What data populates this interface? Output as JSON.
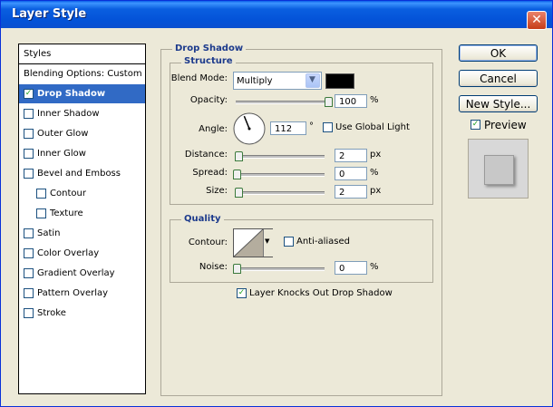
{
  "window": {
    "title": "Layer Style",
    "close_label": "✕"
  },
  "styles_list": {
    "header": "Styles",
    "items": [
      {
        "label": "Blending Options: Custom",
        "checkbox": false,
        "checked": false,
        "indent": 0,
        "selected": false
      },
      {
        "label": "Drop Shadow",
        "checkbox": true,
        "checked": true,
        "indent": 0,
        "selected": true
      },
      {
        "label": "Inner Shadow",
        "checkbox": true,
        "checked": false,
        "indent": 0,
        "selected": false
      },
      {
        "label": "Outer Glow",
        "checkbox": true,
        "checked": false,
        "indent": 0,
        "selected": false
      },
      {
        "label": "Inner Glow",
        "checkbox": true,
        "checked": false,
        "indent": 0,
        "selected": false
      },
      {
        "label": "Bevel and Emboss",
        "checkbox": true,
        "checked": false,
        "indent": 0,
        "selected": false
      },
      {
        "label": "Contour",
        "checkbox": true,
        "checked": false,
        "indent": 1,
        "selected": false
      },
      {
        "label": "Texture",
        "checkbox": true,
        "checked": false,
        "indent": 1,
        "selected": false
      },
      {
        "label": "Satin",
        "checkbox": true,
        "checked": false,
        "indent": 0,
        "selected": false
      },
      {
        "label": "Color Overlay",
        "checkbox": true,
        "checked": false,
        "indent": 0,
        "selected": false
      },
      {
        "label": "Gradient Overlay",
        "checkbox": true,
        "checked": false,
        "indent": 0,
        "selected": false
      },
      {
        "label": "Pattern Overlay",
        "checkbox": true,
        "checked": false,
        "indent": 0,
        "selected": false
      },
      {
        "label": "Stroke",
        "checkbox": true,
        "checked": false,
        "indent": 0,
        "selected": false
      }
    ]
  },
  "drop_shadow": {
    "group_title": "Drop Shadow",
    "structure": {
      "title": "Structure",
      "blend_mode_label": "Blend Mode:",
      "blend_mode_value": "Multiply",
      "shadow_color": "#000000",
      "opacity_label": "Opacity:",
      "opacity_value": "100",
      "opacity_unit": "%",
      "opacity_fraction": 1.0,
      "angle_label": "Angle:",
      "angle_value": "112",
      "angle_unit": "°",
      "angle_degrees": 112,
      "use_global_light_label": "Use Global Light",
      "use_global_light_checked": false,
      "distance_label": "Distance:",
      "distance_value": "2",
      "distance_unit": "px",
      "spread_label": "Spread:",
      "spread_value": "0",
      "spread_unit": "%",
      "size_label": "Size:",
      "size_value": "2",
      "size_unit": "px"
    },
    "quality": {
      "title": "Quality",
      "contour_label": "Contour:",
      "anti_aliased_label": "Anti-aliased",
      "anti_aliased_checked": false,
      "noise_label": "Noise:",
      "noise_value": "0",
      "noise_unit": "%"
    },
    "layer_knocks_out_label": "Layer Knocks Out Drop Shadow",
    "layer_knocks_out_checked": true
  },
  "buttons": {
    "ok": "OK",
    "cancel": "Cancel",
    "new_style": "New Style...",
    "preview_label": "Preview",
    "preview_checked": true
  }
}
